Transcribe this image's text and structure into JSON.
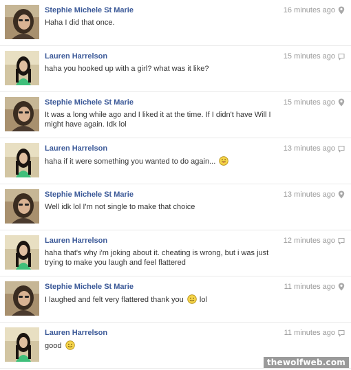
{
  "messages": [
    {
      "sender": "Stephie Michele St Marie",
      "avatar": "stephie",
      "text": "Haha I did that once.",
      "emoji": "",
      "after": "",
      "time": "16 minutes ago",
      "icon": "location-pin-icon"
    },
    {
      "sender": "Lauren Harrelson",
      "avatar": "lauren",
      "text": "haha you hooked up with a girl? what was it like?",
      "emoji": "",
      "after": "",
      "time": "15 minutes ago",
      "icon": "comment-bubble-icon"
    },
    {
      "sender": "Stephie Michele St Marie",
      "avatar": "stephie",
      "text": "It was a long while ago and I liked it at the time. If I didn't have Will I might have again. Idk lol",
      "emoji": "",
      "after": "",
      "time": "15 minutes ago",
      "icon": "location-pin-icon"
    },
    {
      "sender": "Lauren Harrelson",
      "avatar": "lauren",
      "text": "haha if it were something you wanted to do again...",
      "emoji": "tongue-smiley-icon",
      "after": "",
      "time": "13 minutes ago",
      "icon": "comment-bubble-icon"
    },
    {
      "sender": "Stephie Michele St Marie",
      "avatar": "stephie",
      "text": "Well idk lol I'm not single to make that choice",
      "emoji": "",
      "after": "",
      "time": "13 minutes ago",
      "icon": "location-pin-icon"
    },
    {
      "sender": "Lauren Harrelson",
      "avatar": "lauren",
      "text": "haha that's why i'm joking about it. cheating is wrong, but i was just trying to make you laugh and feel flattered",
      "emoji": "",
      "after": "",
      "time": "12 minutes ago",
      "icon": "comment-bubble-icon"
    },
    {
      "sender": "Stephie Michele St Marie",
      "avatar": "stephie",
      "text": "I laughed and felt very flattered thank you",
      "emoji": "smiley-icon",
      "after": "lol",
      "time": "11 minutes ago",
      "icon": "location-pin-icon"
    },
    {
      "sender": "Lauren Harrelson",
      "avatar": "lauren",
      "text": "good",
      "emoji": "smiley-icon",
      "after": "",
      "time": "11 minutes ago",
      "icon": "comment-bubble-icon"
    }
  ],
  "watermark": "thewolfweb.com",
  "colors": {
    "name": "#3b5998",
    "text": "#333333",
    "time": "#999999",
    "divider": "#e9e9e9",
    "smiley_fill": "#f5d44a"
  }
}
